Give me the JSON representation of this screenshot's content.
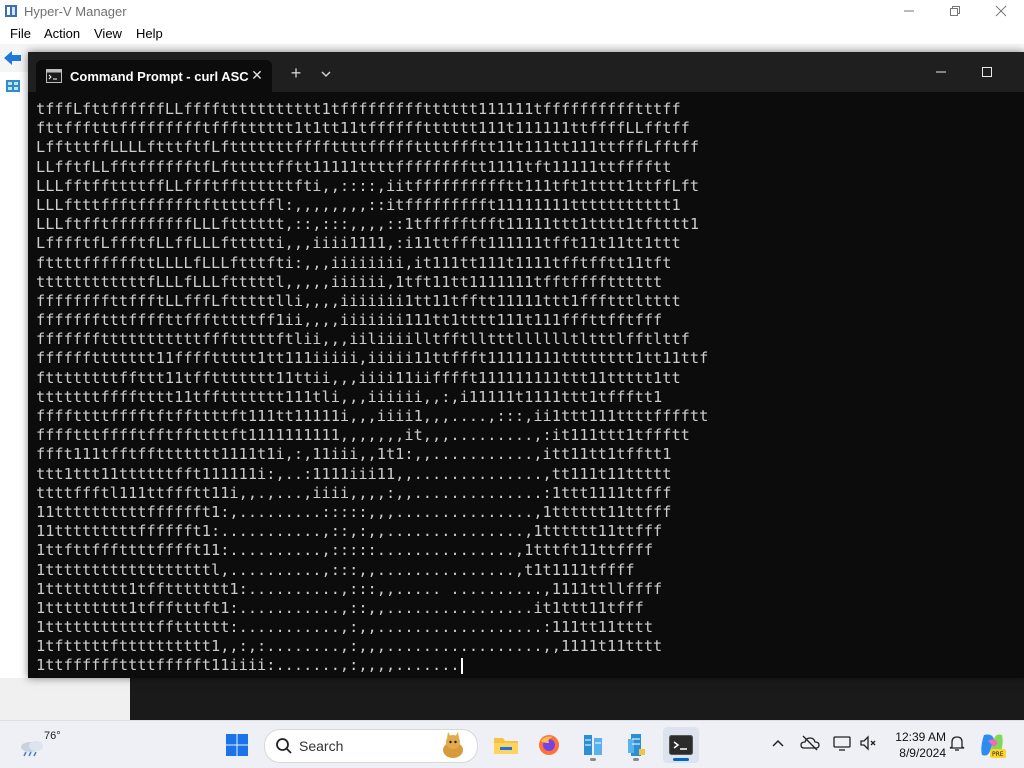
{
  "hyperv": {
    "title": "Hyper-V Manager",
    "menu": [
      "File",
      "Action",
      "View",
      "Help"
    ]
  },
  "terminal": {
    "tab_title": "Command Prompt - curl  ASC",
    "new_tab_symbol": "+",
    "close_symbol": "✕",
    "lines": [
      "tfffLfttffffffLLffffttttttttttt1tffffffffftttttt111111tfffffffffftttff",
      "fttffftttffffffffftffftttttt1t1tt11tfffffftttttt111t111111ttffffLLfftff",
      "LfftttffLLLLftttftfLftttttttffffttttfffffttttffftt11t111tt111ttfffLfftff",
      "LLfftfLLfftfffffftfLftttttfftt11111ttttfffffffftt1111tft11111ttfffftt",
      "LLLfftffttttffLLffftffttttttfti,,::::,iitfffffffffftt111tft1tttt1ttffLft",
      "LLLftttffftfffffftftttttffl:,,,,,,,,::itffffffffft11111111ttttttttttt1",
      "LLLftfftfffffffffLLLftttttt,::,:::,,,,::1tffffftfft11111ttt1tttt1tftttt1",
      "LfffftfLffftfLLffLLLfttttti,,,iiii1111,:i11ttffft111111tfft11t11tt1ttt",
      "fttttffffffttLLLLfLLLftttfti:,,,iiiiiiii,it111tt111t1111tfftfftt11tft",
      "ttttttttttttfLLLfLLLftttttl,,,,,iiiiii,1tft11tt1111111tfftfffftttttt",
      "ffffffffttffftLLfffLftttttlli,,,,iiiiiii1tt11tfftt11111ttt1ffftttltttt",
      "ffffffftttffffttffftttttff1ii,,,,iiiiiii111tt1tttt111t111fffttfftfff",
      "ffffffftttttttttttffftttttftlii,,,iiliiiilltfftlltttlllllltltttlfftlttf",
      "ffffffttttttt11ffffttttt1tt111iiiii,iiiii11ttffft11111111tttttttt1tt11ttf",
      "fttttttttffttt11tffttttttt11ttii,,,iiii11iifffft111111111ttt11ttttt1tt",
      "tttttttfffftttt11tffttttttt111tli,,,iiiiii,,:,i11111t1111ttt1tffftt1",
      "ffffttttfffftftffttttft111tt11111i,,,iiii1,,,....,:::,ii1ttt111ttttfffftt",
      "fffftttfffftfftffttttft1111111111,,,,,,,it,,,.........,:it111ttt1tffftt",
      "ffft111tfftffttttttt1111t1i,:,11iii,,1t1:,,...........,itt11tt1tfftt1",
      "ttt1ttt11ttttttfft111111i:,..:1111iii11,,..............,tt111t11ttttt",
      "ttttffftl111ttffftt11i,,.,...,iiii,,,,:,,..............:1ttt1111ttfff",
      "11ttttttttttfffffft1:,.........:::::,,,...............,1tttttt11ttfff",
      "11tttttttttfffffft1:...........,::,:,,...............,1tttttt11ttfff",
      "1ttfttfffttttfffft11:..........,:::::...............,1tttft11ttffff",
      "1ttttttttttttttttttl,..........,:::,,...............,t1t1111tffff",
      "1ttttttttt1tffttttttt1:..........,:::,,..... ..........,1111ttllffff",
      "1ttttttttt1tffftttft1:...........,::,,................it1ttt11tfff",
      "1ttttttttttttfftttttt:...........,:,,..................:111tt11tttt",
      "1tftttttftttttttttt1,,:,:........,:,,,.................,,1111t11tttt",
      "1ttffffffttttffffft11iiii:.......,:,,,,......."
    ]
  },
  "taskbar": {
    "temperature": "76°",
    "search_label": "Search",
    "time": "12:39 AM",
    "date": "8/9/2024"
  }
}
